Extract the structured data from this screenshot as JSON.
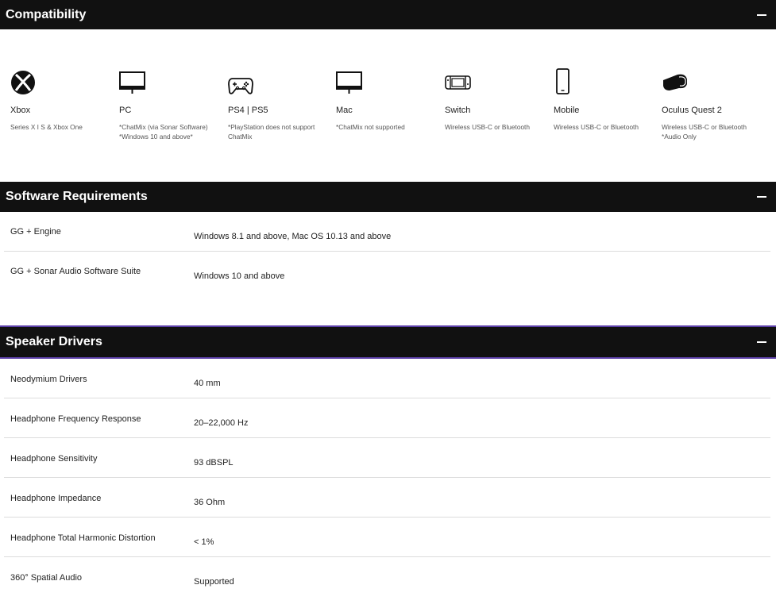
{
  "compatibility": {
    "title": "Compatibility",
    "items": [
      {
        "icon": "xbox-icon",
        "name": "Xbox",
        "note": "Series X I S & Xbox One"
      },
      {
        "icon": "monitor-icon",
        "name": "PC",
        "note": "*ChatMix (via Sonar Software)\n*Windows 10 and above*"
      },
      {
        "icon": "gamepad-icon",
        "name": "PS4 | PS5",
        "note": "*PlayStation does not support\nChatMix"
      },
      {
        "icon": "monitor-icon",
        "name": "Mac",
        "note": "*ChatMix not supported"
      },
      {
        "icon": "switch-icon",
        "name": "Switch",
        "note": "Wireless USB-C or Bluetooth"
      },
      {
        "icon": "phone-icon",
        "name": "Mobile",
        "note": "Wireless USB-C or Bluetooth"
      },
      {
        "icon": "vr-headset-icon",
        "name": "Oculus Quest 2",
        "note": "Wireless USB-C or Bluetooth\n*Audio Only"
      }
    ]
  },
  "software": {
    "title": "Software Requirements",
    "rows": [
      {
        "label": "GG + Engine",
        "value": "Windows 8.1 and above, Mac OS 10.13 and above"
      },
      {
        "label": "GG + Sonar Audio Software Suite",
        "value": "Windows 10 and above"
      }
    ]
  },
  "speaker": {
    "title": "Speaker Drivers",
    "rows": [
      {
        "label": "Neodymium Drivers",
        "value": "40 mm"
      },
      {
        "label": "Headphone Frequency Response",
        "value": "20–22,000 Hz"
      },
      {
        "label": "Headphone Sensitivity",
        "value": "93 dBSPL"
      },
      {
        "label": "Headphone Impedance",
        "value": "36 Ohm"
      },
      {
        "label": "Headphone Total Harmonic Distortion",
        "value": "< 1%"
      },
      {
        "label": "360° Spatial Audio",
        "value": "Supported"
      }
    ]
  },
  "colors": {
    "header_bg": "#111111",
    "accent": "#5b3fa8"
  }
}
